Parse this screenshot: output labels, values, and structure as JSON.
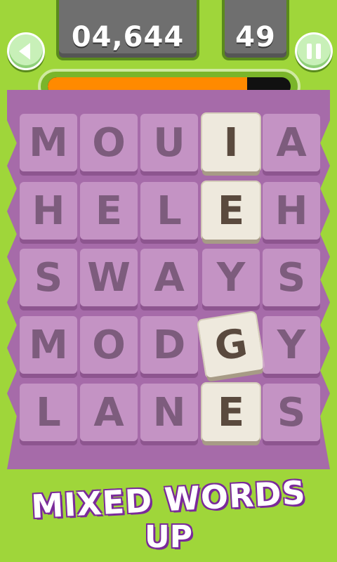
{
  "hud": {
    "score": "04,644",
    "moves": "49",
    "timer_fraction": 0.82
  },
  "grid": [
    [
      "M",
      "O",
      "U",
      "I",
      "A"
    ],
    [
      "H",
      "E",
      "L",
      "E",
      "H"
    ],
    [
      "S",
      "W",
      "A",
      "Y",
      "S"
    ],
    [
      "M",
      "O",
      "D",
      "G",
      "Y"
    ],
    [
      "L",
      "A",
      "N",
      "E",
      "S"
    ]
  ],
  "selected": [
    [
      0,
      3
    ],
    [
      1,
      3
    ],
    [
      3,
      3
    ],
    [
      4,
      3
    ]
  ],
  "logo": {
    "line1": "MIXED WORDS",
    "line2": "UP"
  },
  "colors": {
    "background": "#9fd63a",
    "board": "#a66ba9",
    "timer_fill": "#ff8a00",
    "tile_selected": "#eee9dd"
  },
  "icons": {
    "back": "left-triangle-icon",
    "pause": "pause-icon"
  }
}
